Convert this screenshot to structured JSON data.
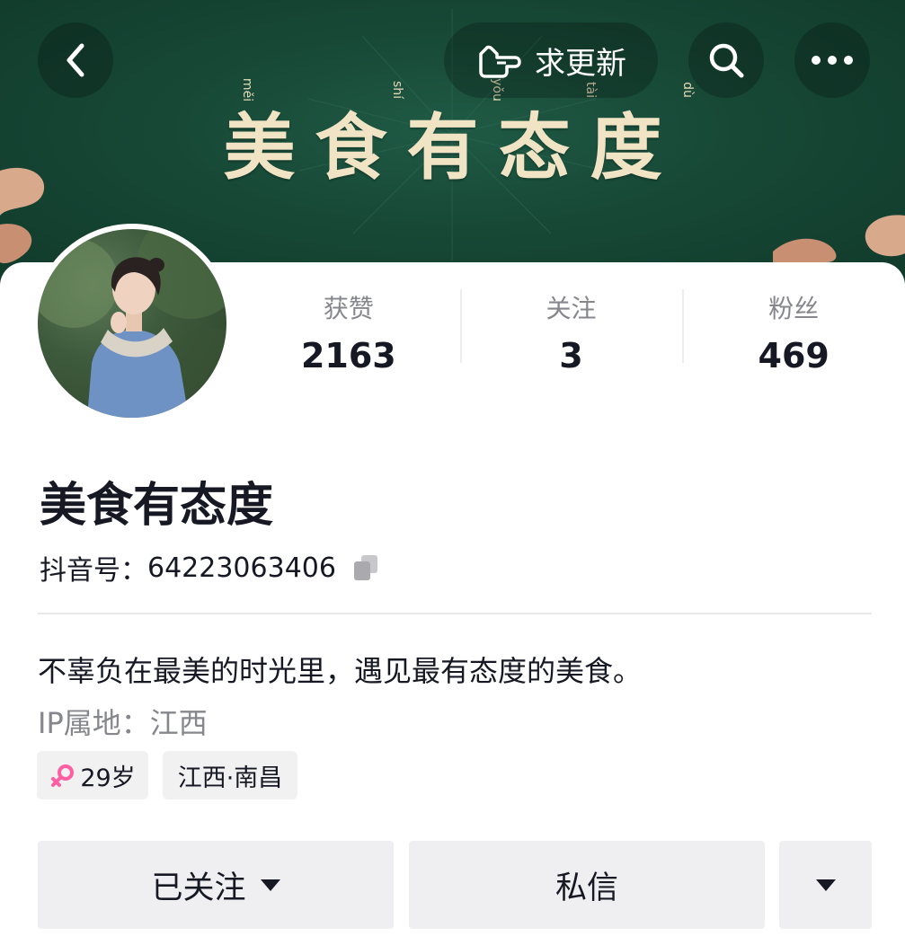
{
  "banner": {
    "title": "美食有态度",
    "pinyin": [
      "měi",
      "shí",
      "yǒu",
      "tài",
      "dù"
    ]
  },
  "topbar": {
    "update_label": "求更新"
  },
  "stats": [
    {
      "label": "获赞",
      "value": "2163"
    },
    {
      "label": "关注",
      "value": "3"
    },
    {
      "label": "粉丝",
      "value": "469"
    }
  ],
  "profile": {
    "name": "美食有态度",
    "id_label": "抖音号：",
    "id_value": "64223063406",
    "bio": "不辜负在最美的时光里，遇见最有态度的美食。",
    "ip_location": "IP属地：江西",
    "tags": {
      "age": "29岁",
      "location": "江西·南昌"
    }
  },
  "actions": {
    "follow_label": "已关注",
    "message_label": "私信"
  },
  "colors": {
    "banner_bg": "#174836",
    "banner_text": "#f1e4c4",
    "female_icon": "#ff5fa2",
    "button_bg": "#efeff1"
  },
  "icons": [
    "back-icon",
    "hand-pointer-icon",
    "search-icon",
    "more-icon",
    "copy-icon",
    "female-icon",
    "caret-down-icon"
  ]
}
